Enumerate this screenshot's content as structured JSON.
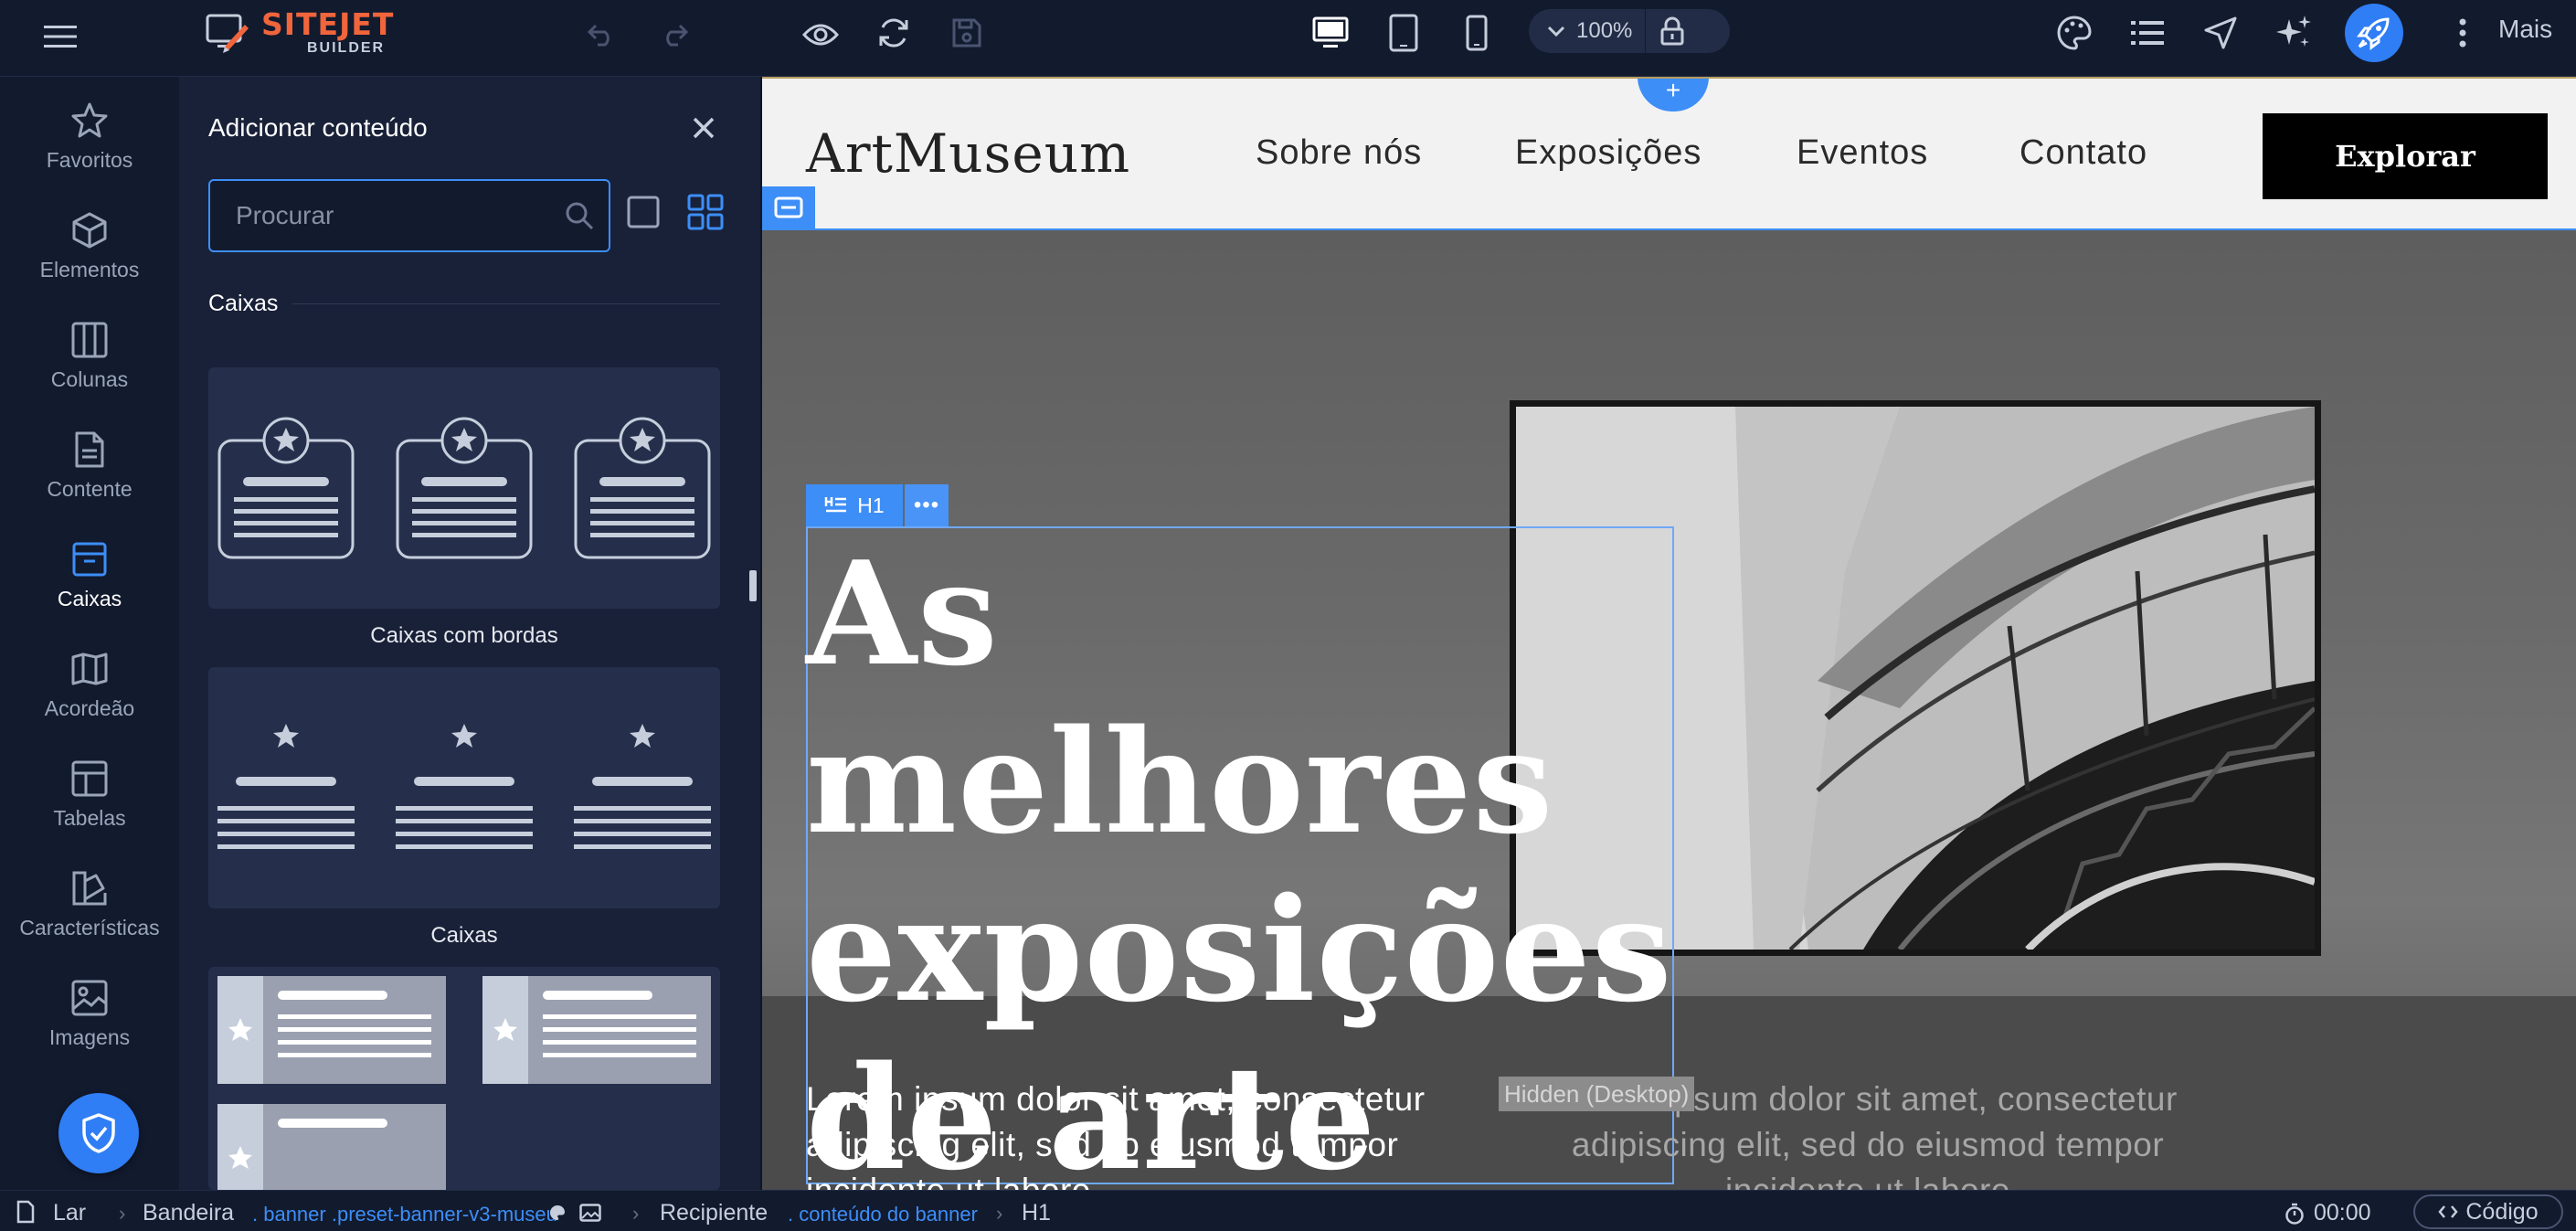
{
  "app": {
    "logo_main": "SITEJET",
    "logo_sub": "BUILDER",
    "zoom": "100%",
    "more_label": "Mais"
  },
  "colors": {
    "accent": "#3d8ef7",
    "brand_orange": "#f0653c",
    "chrome_bg": "#121a2e",
    "panel_bg": "#192138",
    "card_bg": "#252f4b"
  },
  "toolbar": {
    "icons": [
      "menu-icon",
      "undo-icon",
      "redo-icon",
      "preview-eye-icon",
      "refresh-icon",
      "save-icon",
      "desktop-icon",
      "tablet-icon",
      "mobile-icon",
      "chevron-down-icon",
      "lock-icon",
      "palette-icon",
      "list-icon",
      "navigation-icon",
      "sparkles-icon",
      "rocket-icon",
      "more-vertical-icon"
    ]
  },
  "rail": {
    "items": [
      {
        "label": "Favoritos",
        "icon": "star-icon"
      },
      {
        "label": "Elementos",
        "icon": "cube-icon"
      },
      {
        "label": "Colunas",
        "icon": "columns-icon"
      },
      {
        "label": "Contente",
        "icon": "document-icon"
      },
      {
        "label": "Caixas",
        "icon": "box-icon"
      },
      {
        "label": "Acordeão",
        "icon": "accordion-icon"
      },
      {
        "label": "Tabelas",
        "icon": "table-icon"
      },
      {
        "label": "Características",
        "icon": "features-icon"
      },
      {
        "label": "Imagens",
        "icon": "image-icon"
      }
    ],
    "active_index": 4
  },
  "panel": {
    "title": "Adicionar conteúdo",
    "search_placeholder": "Procurar",
    "section": "Caixas",
    "cards": [
      {
        "label": "Caixas com bordas"
      },
      {
        "label": "Caixas"
      }
    ]
  },
  "site": {
    "logo": "ArtMuseum",
    "nav": [
      "Sobre nós",
      "Exposições",
      "Eventos",
      "Contato"
    ],
    "cta": "Explorar",
    "h1_tag": "H1",
    "h1_lines": [
      "As",
      "melhores",
      "exposições",
      "de arte"
    ],
    "lorem": [
      "Lorem ipsum dolor sit amet, consectetur",
      "adipiscing elit, sed do eiusmod tempor",
      "incidente ut labore"
    ],
    "lorem_ghost": [
      "Lorem ipsum dolor sit amet, consectetur",
      "adipiscing elit, sed do eiusmod tempor",
      "incidente ut labore"
    ],
    "hidden_tag": "Hidden (Desktop)"
  },
  "breadcrumb": {
    "items": [
      {
        "label": "Lar"
      },
      {
        "label": "Bandeira",
        "classes": ". banner .preset-banner-v3-museu"
      },
      {
        "label": "Recipiente",
        "classes": ". conteúdo do banner"
      },
      {
        "label": "H1"
      }
    ],
    "timer": "00:00",
    "code_label": "Código"
  }
}
